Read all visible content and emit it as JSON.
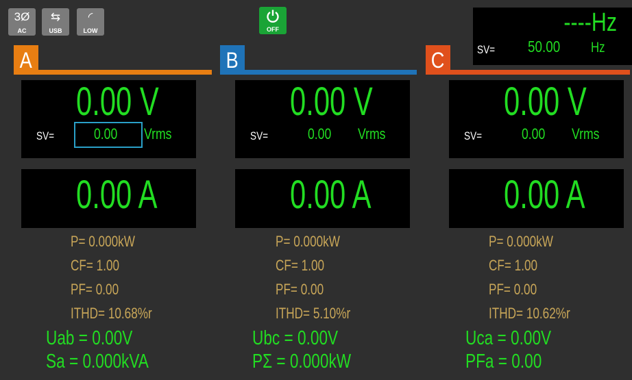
{
  "status_icons": [
    {
      "top": "3Ø",
      "label": "AC"
    },
    {
      "top": "⇆",
      "label": "USB"
    },
    {
      "top": "◜",
      "label": "LOW"
    }
  ],
  "power": {
    "label": "OFF"
  },
  "frequency": {
    "reading": "----Hz",
    "sv_label": "SV=",
    "sv_value": "50.00",
    "sv_unit": "Hz"
  },
  "phases": [
    {
      "name": "A",
      "color": "#e87e12",
      "voltage": "0.00 V",
      "sv_label": "SV=",
      "sv_value": "0.00",
      "sv_unit": "Vrms",
      "current": "0.00 A",
      "p": "P=  0.000kW",
      "cf": "CF= 1.00",
      "pf": "PF= 0.00",
      "ithd": "ITHD= 10.68%r",
      "line1": "Uab =  0.00V",
      "line2": "Sa =   0.000kVA"
    },
    {
      "name": "B",
      "color": "#1f73b8",
      "voltage": "0.00 V",
      "sv_label": "SV=",
      "sv_value": "0.00",
      "sv_unit": "Vrms",
      "current": "0.00 A",
      "p": "P=  0.000kW",
      "cf": "CF= 1.00",
      "pf": "PF= 0.00",
      "ithd": "ITHD=  5.10%r",
      "line1": "Ubc =  0.00V",
      "line2": "PΣ =    0.000kW"
    },
    {
      "name": "C",
      "color": "#e0501c",
      "voltage": "0.00 V",
      "sv_label": "SV=",
      "sv_value": "0.00",
      "sv_unit": "Vrms",
      "current": "0.00 A",
      "p": "P=  0.000kW",
      "cf": "CF= 1.00",
      "pf": "PF= 0.00",
      "ithd": "ITHD= 10.62%r",
      "line1": "Uca =  0.00V",
      "line2": "PFa  =  0.00"
    }
  ]
}
